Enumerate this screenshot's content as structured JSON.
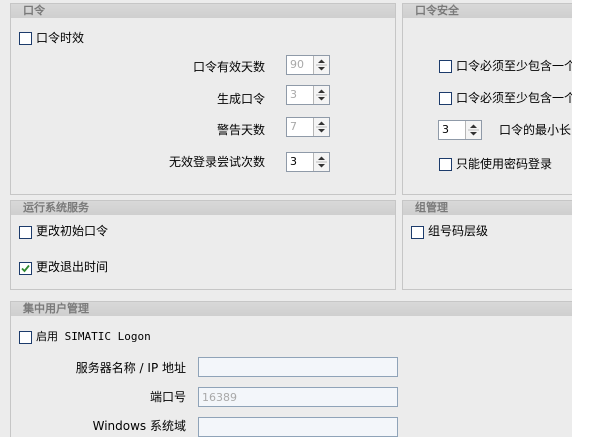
{
  "password_group": {
    "title": "口令",
    "expiry_checkbox": {
      "label": "口令时效",
      "checked": false
    },
    "valid_days": {
      "label": "口令有效天数",
      "value": "90",
      "disabled": true
    },
    "generations": {
      "label": "生成口令",
      "value": "3",
      "disabled": true
    },
    "warning_days": {
      "label": "警告天数",
      "value": "7",
      "disabled": true
    },
    "failed_logins": {
      "label": "无效登录尝试次数",
      "value": "3",
      "disabled": false
    }
  },
  "security_group": {
    "title": "口令安全",
    "must_contain_1": {
      "label": "口令必须至少包含一个",
      "checked": false
    },
    "must_contain_2": {
      "label": "口令必须至少包含一个",
      "checked": false
    },
    "min_length": {
      "value": "3",
      "label": "口令的最小长"
    },
    "pin_only": {
      "label": "只能使用密码登录",
      "checked": false
    }
  },
  "runtime_group": {
    "title": "运行系统服务",
    "change_initial": {
      "label": "更改初始口令",
      "checked": false
    },
    "change_logout": {
      "label": "更改退出时间",
      "checked": true
    }
  },
  "group_mgmt": {
    "title": "组管理",
    "group_hierarchy": {
      "label": "组号码层级",
      "checked": false
    }
  },
  "central_group": {
    "title": "集中用户管理",
    "enable_logon": {
      "label": "启用 SIMATIC Logon",
      "checked": false
    },
    "server_name": {
      "label": "服务器名称 / IP 地址",
      "value": ""
    },
    "port": {
      "label": "端口号",
      "value": "16389"
    },
    "windows_domain": {
      "label": "Windows 系统域",
      "value": ""
    }
  }
}
